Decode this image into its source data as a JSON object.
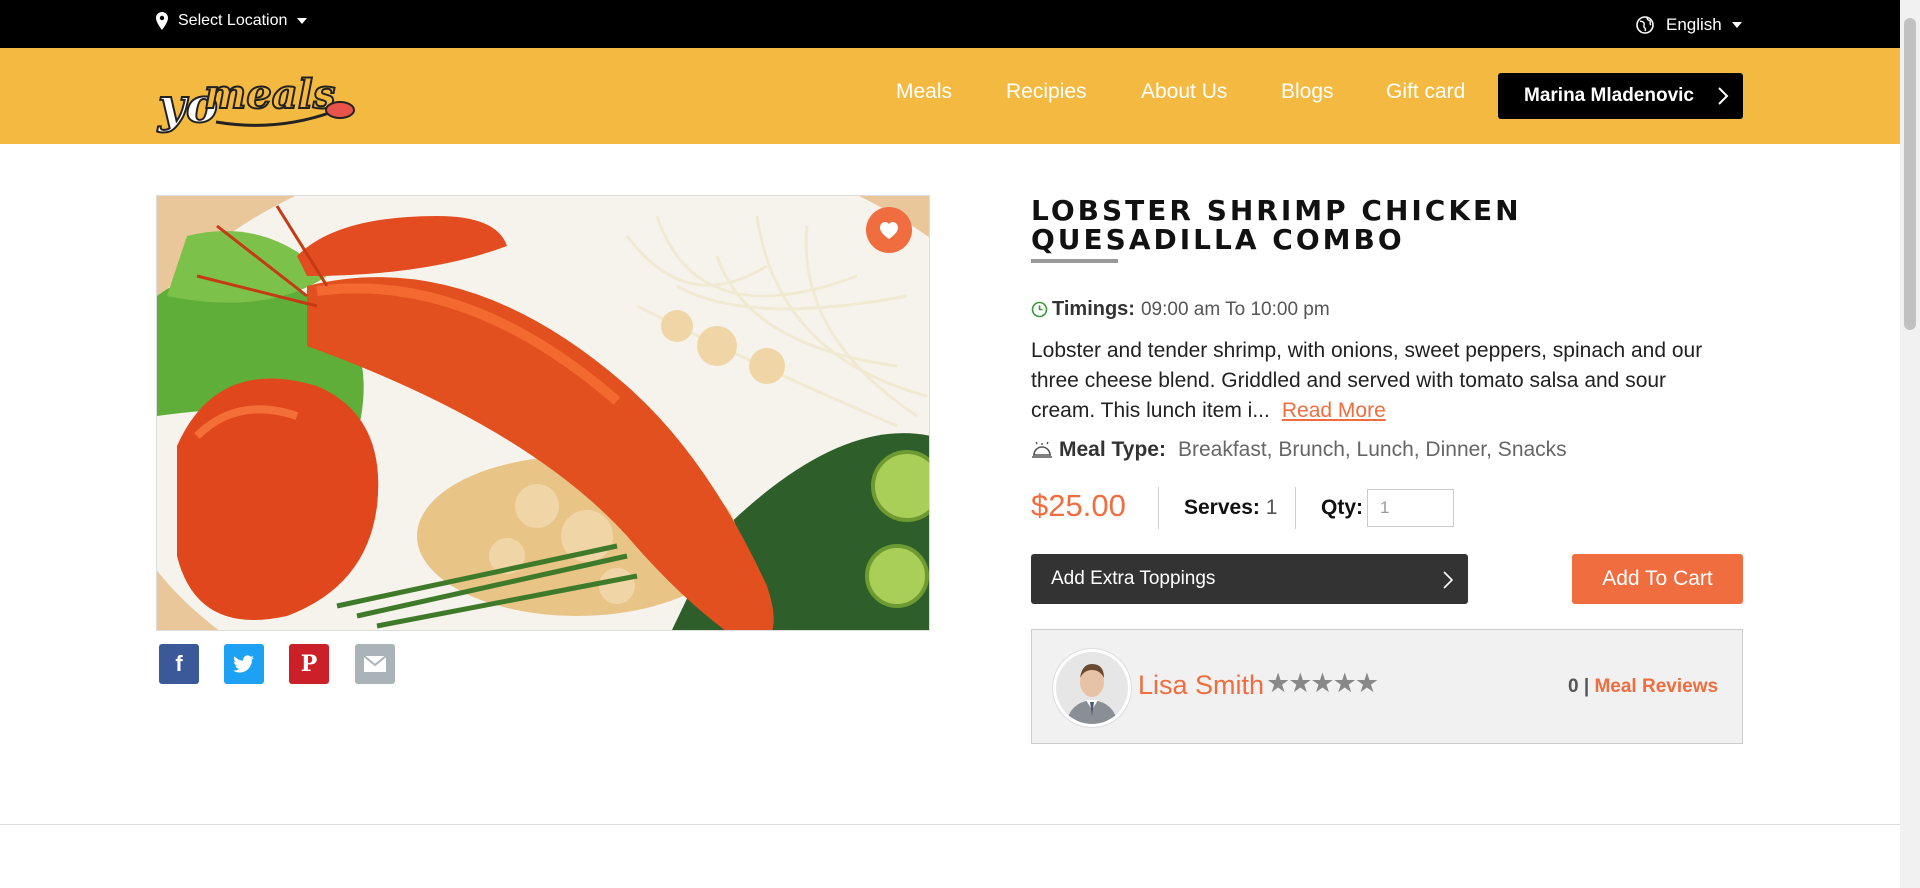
{
  "topbar": {
    "location_label": "Select Location",
    "language_label": "English"
  },
  "brand": {
    "logo_text_yo": "yo",
    "logo_text_meals": "meals",
    "accent": "#f4b940",
    "orange": "#ef6d3f"
  },
  "nav": {
    "items": [
      {
        "label": "Meals"
      },
      {
        "label": "Recipies"
      },
      {
        "label": "About Us"
      },
      {
        "label": "Blogs"
      },
      {
        "label": "Gift card"
      }
    ],
    "user_label": "Marina Mladenovic"
  },
  "product": {
    "title": "LOBSTER SHRIMP CHICKEN QUESADILLA COMBO",
    "timings_label": "Timings:",
    "timings_value": "09:00 am To 10:00 pm",
    "description": "Lobster and tender shrimp, with onions, sweet peppers, spinach and our three cheese blend. Griddled and served with tomato salsa and sour cream. This lunch item i...",
    "read_more": "Read More",
    "meal_type_label": "Meal Type:",
    "meal_type_value": "Breakfast, Brunch, Lunch, Dinner, Snacks",
    "price": "$25.00",
    "serves_label": "Serves:",
    "serves_value": "1",
    "qty_label": "Qty:",
    "qty_value": "1",
    "toppings_label": "Add Extra Toppings",
    "add_to_cart": "Add To Cart"
  },
  "chef": {
    "name": "Lisa Smith",
    "stars": "★★★★★",
    "rating": 0,
    "review_count": "0",
    "separator": "|",
    "reviews_label": "Meal Reviews"
  },
  "social": {
    "facebook_glyph": "f",
    "pinterest_glyph": "P",
    "colors": {
      "facebook": "#3b5998",
      "twitter": "#1da1f2",
      "pinterest": "#cb2027",
      "email": "#aab4b8"
    }
  }
}
